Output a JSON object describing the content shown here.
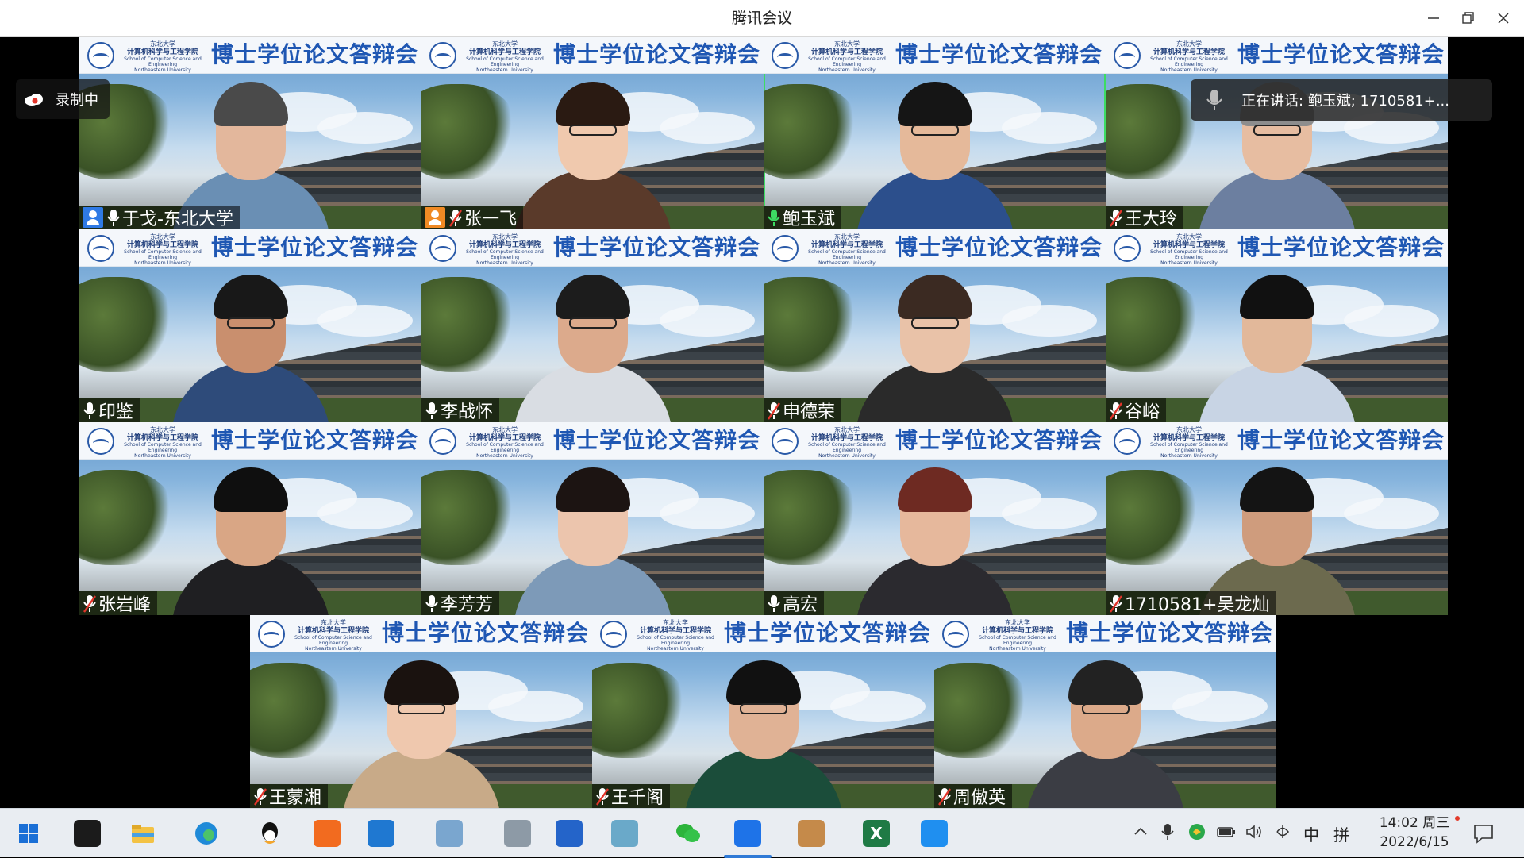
{
  "window": {
    "title": "腾讯会议"
  },
  "overlays": {
    "recording_label": "录制中",
    "speaking_text": "正在讲话: 鲍玉斌; 1710581+..."
  },
  "banner": {
    "university": "东北大学",
    "department": "计算机科学与工程学院",
    "department_en": "School of Computer Science and Engineering",
    "university_en": "Northeastern University",
    "title": "博士学位论文答辩会"
  },
  "participants": [
    {
      "name": "于戈-东北大学",
      "mic": "on",
      "host": true,
      "host_color": "#2f7ae5"
    },
    {
      "name": "张一飞",
      "mic": "muted",
      "host": true,
      "host_color": "#f08a24"
    },
    {
      "name": "鲍玉斌",
      "mic": "speaking",
      "host": false
    },
    {
      "name": "王大玲",
      "mic": "muted",
      "host": false
    },
    {
      "name": "印鉴",
      "mic": "on",
      "host": false
    },
    {
      "name": "李战怀",
      "mic": "on",
      "host": false
    },
    {
      "name": "申德荣",
      "mic": "muted",
      "host": false
    },
    {
      "name": "谷峪",
      "mic": "muted",
      "host": false
    },
    {
      "name": "张岩峰",
      "mic": "muted",
      "host": false
    },
    {
      "name": "李芳芳",
      "mic": "on",
      "host": false
    },
    {
      "name": "高宏",
      "mic": "on",
      "host": false
    },
    {
      "name": "1710581+吴龙灿",
      "mic": "muted",
      "host": false
    },
    {
      "name": "王蒙湘",
      "mic": "muted",
      "host": false
    },
    {
      "name": "王千阁",
      "mic": "muted",
      "host": false
    },
    {
      "name": "周傲英",
      "mic": "muted",
      "host": false
    }
  ],
  "taskbar": {
    "apps": [
      {
        "icon": "windows-start-icon",
        "color": "#1a6fd6"
      },
      {
        "icon": "pinwheel-icon",
        "color": "#1b1b1b"
      },
      {
        "icon": "file-explorer-icon",
        "color": "#f3c244"
      },
      {
        "icon": "edge-browser-icon",
        "color": "#1f8ad8"
      },
      {
        "icon": "qq-icon",
        "color": "#111111"
      },
      {
        "icon": "office-icon",
        "color": "#f26b1f"
      },
      {
        "icon": "tiles-app-icon",
        "color": "#1f78d1"
      },
      {
        "icon": "scanner-icon",
        "color": "#7aa6cf"
      },
      {
        "icon": "gear-tool-icon",
        "color": "#8d9aa6"
      },
      {
        "icon": "powershell-icon",
        "color": "#2464c9"
      },
      {
        "icon": "notes-icon",
        "color": "#6aa9c9"
      },
      {
        "icon": "wechat-icon",
        "color": "#2cb43b"
      },
      {
        "icon": "tencent-meeting-icon",
        "color": "#1e73e8"
      },
      {
        "icon": "paint-icon",
        "color": "#c58a4a"
      },
      {
        "icon": "excel-icon",
        "color": "#1f7a45"
      },
      {
        "icon": "feishu-icon",
        "color": "#1f8ff0"
      }
    ],
    "ime_lang": "中",
    "ime_mode": "拼",
    "time": "14:02 周三",
    "date": "2022/6/15"
  }
}
